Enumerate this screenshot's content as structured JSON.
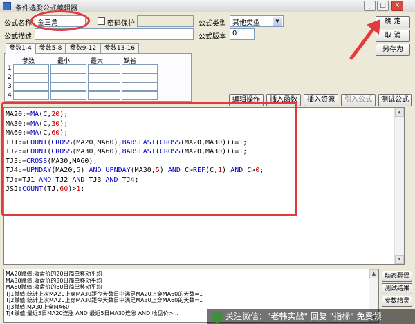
{
  "window": {
    "title": "条件选股公式编辑器",
    "controls": {
      "minimize": "_",
      "maximize": "□",
      "close": "×"
    }
  },
  "form": {
    "name_label": "公式名称",
    "name_value": "金三角",
    "password_label": "密码保护",
    "type_label": "公式类型",
    "type_value": "其他类型",
    "desc_label": "公式描述",
    "version_label": "公式版本",
    "version_value": "0"
  },
  "buttons": {
    "confirm": "确  定",
    "cancel": "取  消",
    "save_as": "另存为",
    "edit_ops": "编辑操作",
    "insert_func": "插入函数",
    "insert_resource": "插入资源",
    "import_formula": "引入公式",
    "test_formula": "测试公式",
    "dynamic_translate": "动态翻译",
    "test_result": "测试结果",
    "param_wizard": "参数精灵"
  },
  "tabs": [
    "参数1-4",
    "参数5-8",
    "参数9-12",
    "参数13-16"
  ],
  "param_table": {
    "headers": [
      "参数",
      "最小",
      "最大",
      "缺省"
    ],
    "rows": [
      "1",
      "2",
      "3",
      "4"
    ]
  },
  "code_lines": [
    [
      {
        "t": "MA20:="
      },
      {
        "t": "MA",
        "k": "fn"
      },
      {
        "t": "(C,"
      },
      {
        "t": "20",
        "k": "num"
      },
      {
        "t": ");"
      }
    ],
    [
      {
        "t": "MA30:="
      },
      {
        "t": "MA",
        "k": "fn"
      },
      {
        "t": "(C,"
      },
      {
        "t": "30",
        "k": "num"
      },
      {
        "t": ");"
      }
    ],
    [
      {
        "t": "MA60:="
      },
      {
        "t": "MA",
        "k": "fn"
      },
      {
        "t": "(C,"
      },
      {
        "t": "60",
        "k": "num"
      },
      {
        "t": ");"
      }
    ],
    [
      {
        "t": "TJ1:="
      },
      {
        "t": "COUNT",
        "k": "fn"
      },
      {
        "t": "("
      },
      {
        "t": "CROSS",
        "k": "fn"
      },
      {
        "t": "(MA20,MA60),"
      },
      {
        "t": "BARSLAST",
        "k": "fn"
      },
      {
        "t": "("
      },
      {
        "t": "CROSS",
        "k": "fn"
      },
      {
        "t": "(MA20,MA30)))="
      },
      {
        "t": "1",
        "k": "num"
      },
      {
        "t": ";"
      }
    ],
    [
      {
        "t": "TJ2:="
      },
      {
        "t": "COUNT",
        "k": "fn"
      },
      {
        "t": "("
      },
      {
        "t": "CROSS",
        "k": "fn"
      },
      {
        "t": "(MA30,MA60),"
      },
      {
        "t": "BARSLAST",
        "k": "fn"
      },
      {
        "t": "("
      },
      {
        "t": "CROSS",
        "k": "fn"
      },
      {
        "t": "(MA20,MA30)))="
      },
      {
        "t": "1",
        "k": "num"
      },
      {
        "t": ";"
      }
    ],
    [
      {
        "t": "TJ3:="
      },
      {
        "t": "CROSS",
        "k": "fn"
      },
      {
        "t": "(MA30,MA60);"
      }
    ],
    [
      {
        "t": "TJ4:="
      },
      {
        "t": "UPNDAY",
        "k": "fn"
      },
      {
        "t": "(MA20,"
      },
      {
        "t": "5",
        "k": "num"
      },
      {
        "t": ") "
      },
      {
        "t": "AND",
        "k": "fn"
      },
      {
        "t": " "
      },
      {
        "t": "UPNDAY",
        "k": "fn"
      },
      {
        "t": "(MA30,"
      },
      {
        "t": "5",
        "k": "num"
      },
      {
        "t": ") "
      },
      {
        "t": "AND",
        "k": "fn"
      },
      {
        "t": " C>"
      },
      {
        "t": "REF",
        "k": "fn"
      },
      {
        "t": "(C,"
      },
      {
        "t": "1",
        "k": "num"
      },
      {
        "t": ") "
      },
      {
        "t": "AND",
        "k": "fn"
      },
      {
        "t": " C>"
      },
      {
        "t": "0",
        "k": "num"
      },
      {
        "t": ";"
      }
    ],
    [
      {
        "t": "TJ:=TJ1 "
      },
      {
        "t": "AND",
        "k": "fn"
      },
      {
        "t": " TJ2 "
      },
      {
        "t": "AND",
        "k": "fn"
      },
      {
        "t": " TJ3 "
      },
      {
        "t": "AND",
        "k": "fn"
      },
      {
        "t": " TJ4;"
      }
    ],
    [
      {
        "t": "JSJ:"
      },
      {
        "t": "COUNT",
        "k": "fn"
      },
      {
        "t": "(TJ,"
      },
      {
        "t": "60",
        "k": "num"
      },
      {
        "t": ")>"
      },
      {
        "t": "1",
        "k": "num"
      },
      {
        "t": ";"
      }
    ]
  ],
  "description_lines": [
    "MA20赋值:收盘价的20日简单移动平均",
    "MA30赋值:收盘价的30日简单移动平均",
    "MA60赋值:收盘价的60日简单移动平均",
    "TJ1赋值:统计上次MA20上穿MA30距今天数日中满足MA20上穿MA60的天数=1",
    "TJ2赋值:统计上次MA20上穿MA30距今天数日中满足MA30上穿MA60的天数=1",
    "TJ3赋值:MA30上穿MA60",
    "TJ4赋值:最近5日MA20连涨 AND 最近5日MA30连涨 AND 收盘价>..."
  ],
  "watermark": {
    "text": "关注微信：\"老韩实战\" 回复 \"指标\" 免费领",
    "logo_icon": "wechat-logo"
  },
  "colors": {
    "highlight": "#e23b3b",
    "function": "#0000c8",
    "number": "#c80000"
  }
}
